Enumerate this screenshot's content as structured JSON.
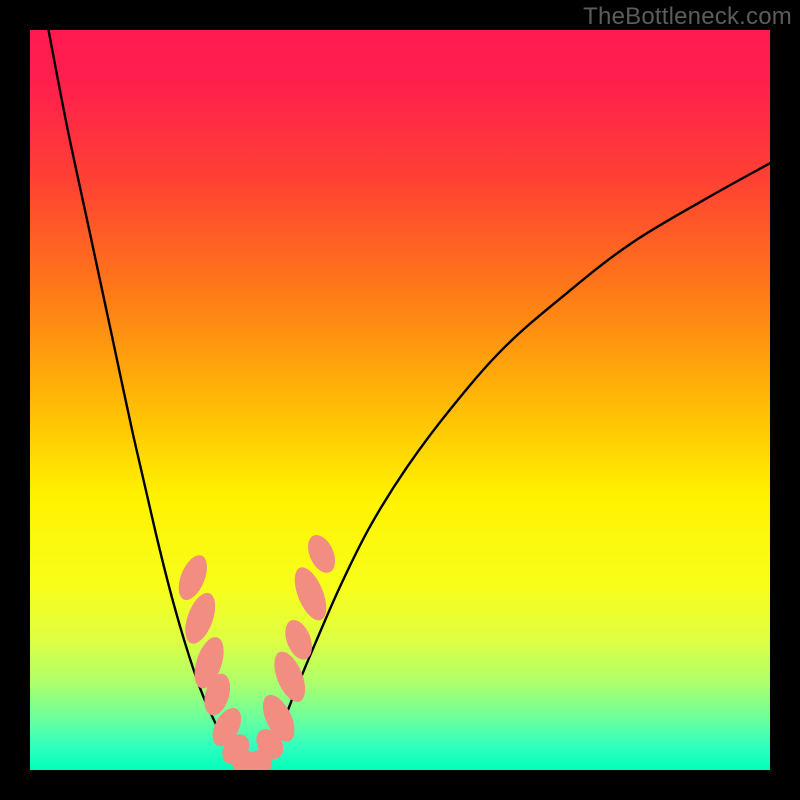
{
  "watermark": "TheBottleneck.com",
  "chart_data": {
    "type": "line",
    "title": "",
    "xlabel": "",
    "ylabel": "",
    "xlim": [
      0,
      100
    ],
    "ylim": [
      0,
      100
    ],
    "gradient_stops": [
      {
        "offset": 0.0,
        "color": "#ff1a50"
      },
      {
        "offset": 0.07,
        "color": "#ff1f4d"
      },
      {
        "offset": 0.2,
        "color": "#ff4034"
      },
      {
        "offset": 0.35,
        "color": "#ff7818"
      },
      {
        "offset": 0.5,
        "color": "#ffb806"
      },
      {
        "offset": 0.63,
        "color": "#fff200"
      },
      {
        "offset": 0.75,
        "color": "#f8fe1a"
      },
      {
        "offset": 0.82,
        "color": "#e0ff40"
      },
      {
        "offset": 0.88,
        "color": "#b0ff6a"
      },
      {
        "offset": 0.93,
        "color": "#6cff9c"
      },
      {
        "offset": 0.97,
        "color": "#2effc0"
      },
      {
        "offset": 1.0,
        "color": "#00ffba"
      }
    ],
    "series": [
      {
        "name": "curve-left",
        "x": [
          2.5,
          5,
          8,
          11,
          14,
          17,
          19,
          21,
          23,
          24.5,
          26,
          27.3,
          28.5
        ],
        "y": [
          100,
          87,
          73,
          59,
          45,
          32,
          24,
          17,
          11,
          7.5,
          4.5,
          2.4,
          1.0
        ]
      },
      {
        "name": "curve-right",
        "x": [
          31,
          32.5,
          34,
          36,
          38.5,
          42,
          46,
          51,
          57,
          64,
          72,
          81,
          91,
          100
        ],
        "y": [
          1.0,
          3.0,
          6.0,
          11,
          17,
          25,
          33,
          41,
          49,
          57,
          64,
          71,
          77,
          82
        ]
      },
      {
        "name": "curve-bottom",
        "x": [
          28.5,
          29.5,
          30.2,
          31
        ],
        "y": [
          1.0,
          0.5,
          0.5,
          1.0
        ]
      }
    ],
    "markers": [
      {
        "cx": 22.0,
        "cy": 26.0,
        "rx": 1.6,
        "ry": 3.2,
        "rot": 22
      },
      {
        "cx": 23.0,
        "cy": 20.5,
        "rx": 1.7,
        "ry": 3.6,
        "rot": 20
      },
      {
        "cx": 24.2,
        "cy": 14.5,
        "rx": 1.7,
        "ry": 3.6,
        "rot": 18
      },
      {
        "cx": 25.3,
        "cy": 10.2,
        "rx": 1.6,
        "ry": 2.9,
        "rot": 16
      },
      {
        "cx": 26.6,
        "cy": 5.8,
        "rx": 1.6,
        "ry": 2.8,
        "rot": 28
      },
      {
        "cx": 27.8,
        "cy": 2.8,
        "rx": 1.6,
        "ry": 2.2,
        "rot": 35
      },
      {
        "cx": 29.0,
        "cy": 1.0,
        "rx": 1.7,
        "ry": 1.7,
        "rot": 0
      },
      {
        "cx": 31.0,
        "cy": 1.0,
        "rx": 1.7,
        "ry": 1.7,
        "rot": 0
      },
      {
        "cx": 32.4,
        "cy": 3.5,
        "rx": 1.6,
        "ry": 2.2,
        "rot": -35
      },
      {
        "cx": 33.6,
        "cy": 7.0,
        "rx": 1.7,
        "ry": 3.4,
        "rot": -26
      },
      {
        "cx": 35.1,
        "cy": 12.6,
        "rx": 1.7,
        "ry": 3.6,
        "rot": -22
      },
      {
        "cx": 36.3,
        "cy": 17.6,
        "rx": 1.6,
        "ry": 2.8,
        "rot": -21
      },
      {
        "cx": 37.9,
        "cy": 23.8,
        "rx": 1.7,
        "ry": 3.8,
        "rot": -22
      },
      {
        "cx": 39.4,
        "cy": 29.2,
        "rx": 1.6,
        "ry": 2.7,
        "rot": -24
      }
    ],
    "marker_color": "#f28d82"
  }
}
